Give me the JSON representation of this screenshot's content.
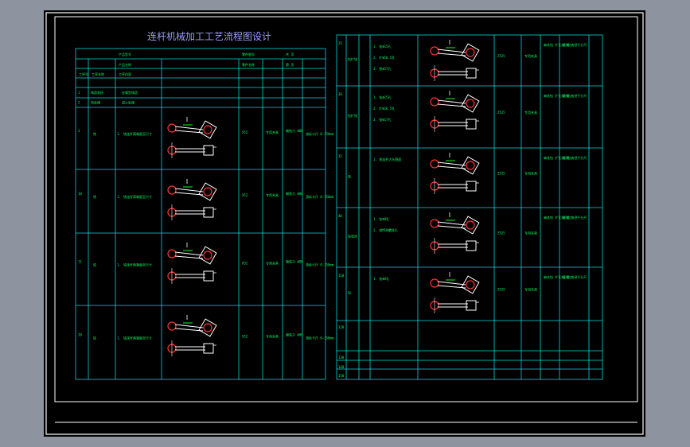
{
  "title": "连杆机械加工工艺流程图设计",
  "colors": {
    "background": "#8d949f",
    "canvas": "#000000",
    "frame": "#ffffff",
    "table_lines": "#00d8d8",
    "part": "#ffffff",
    "hole": "#ff3030",
    "dimension": "#00ff00",
    "title": "#9c9cff",
    "text": "#00ff66"
  },
  "left_table": {
    "header_rows": [
      [
        "",
        "",
        "产品型号",
        "",
        "零件图号",
        "",
        "共 页",
        ""
      ],
      [
        "",
        "",
        "产品名称",
        "",
        "零件名称",
        "",
        "第 页",
        ""
      ],
      [
        "工序号",
        "工序名称",
        "工序内容",
        "",
        "",
        "",
        "",
        ""
      ]
    ],
    "setup_rows": [
      [
        "1",
        "铸造毛坯",
        "金属型铸造"
      ],
      [
        "2",
        "热处理",
        "退火处理"
      ]
    ],
    "process_rows": [
      {
        "no": "3",
        "name": "铣",
        "step": "1.",
        "content": "铣连杆两端面至尺寸"
      },
      {
        "no": "10",
        "name": "铣",
        "step": "1.",
        "content": "铣连杆两端面至尺寸"
      },
      {
        "no": "11",
        "name": "铣",
        "step": "1.",
        "content": "铣连杆两端面至尺寸"
      },
      {
        "no": "20",
        "name": "铣",
        "step": "1.",
        "content": "铣连杆两端面至尺寸"
      }
    ],
    "machine": "X52",
    "fixture": "专用夹具",
    "tool": "端铣刀 Φ80",
    "gauge": "游标卡尺 0-150mm"
  },
  "right_table": {
    "rows": [
      {
        "no": "25",
        "name": "钻扩铰",
        "steps": [
          "1. 钻Φ15孔",
          "2. 扩Φ16.5孔",
          "3. 铰Φ17孔"
        ]
      },
      {
        "no": "30",
        "name": "钻扩铰",
        "steps": [
          "1. 钻Φ15孔",
          "2. 扩Φ16.5孔",
          "3. 铰Φ17孔"
        ]
      },
      {
        "no": "35",
        "name": "铣",
        "steps": [
          "1. 铣连杆大头侧面"
        ]
      },
      {
        "no": "40",
        "name": "钻攻丝",
        "steps": [
          "1. 钻Φ8孔",
          "2. 攻M10螺纹孔"
        ]
      },
      {
        "no": "110",
        "name": "钻",
        "steps": [
          "1. 钻Φ6孔"
        ]
      }
    ],
    "empty_row_numbers": [
      "120",
      "130",
      "140",
      "150"
    ],
    "machine": "Z525",
    "fixture": "专用夹具",
    "tool": "麻花钻 扩孔钻 铰刀",
    "gauge": "塞规 内径千分尺"
  }
}
